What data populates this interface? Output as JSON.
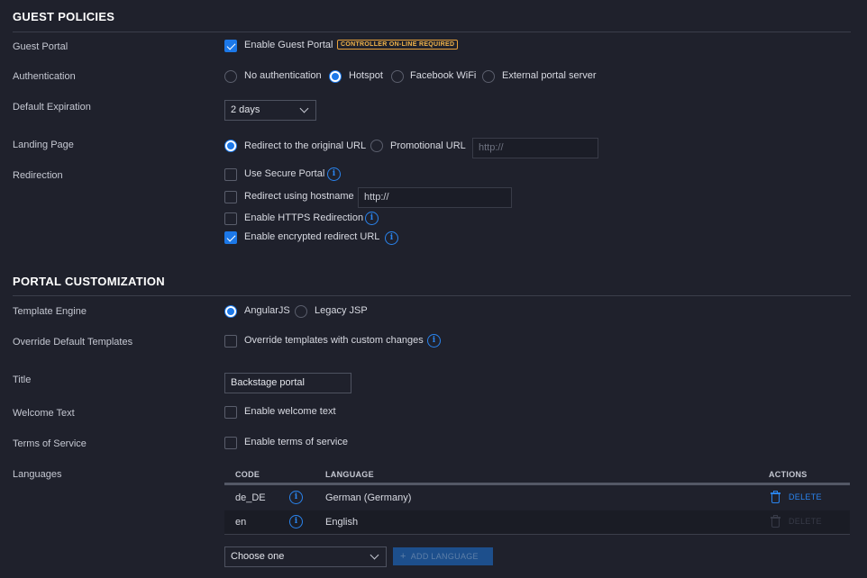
{
  "guest_policies": {
    "title": "GUEST POLICIES",
    "guest_portal": {
      "label": "Guest Portal",
      "checkbox_label": "Enable Guest Portal",
      "checked": true,
      "badge": "CONTROLLER ON-LINE REQUIRED"
    },
    "authentication": {
      "label": "Authentication",
      "options": [
        "No authentication",
        "Hotspot",
        "Facebook WiFi",
        "External portal server"
      ],
      "selected": "Hotspot"
    },
    "default_expiration": {
      "label": "Default Expiration",
      "value": "2 days"
    },
    "landing_page": {
      "label": "Landing Page",
      "options": [
        "Redirect to the original URL",
        "Promotional URL"
      ],
      "selected": "Redirect to the original URL",
      "url_placeholder": "http://"
    },
    "redirection": {
      "label": "Redirection",
      "use_secure_portal": "Use Secure Portal",
      "redirect_hostname": "Redirect using hostname",
      "hostname_value": "http://",
      "https_redirection": "Enable HTTPS Redirection",
      "encrypted_redirect": "Enable encrypted redirect URL"
    }
  },
  "portal_customization": {
    "title": "PORTAL CUSTOMIZATION",
    "template_engine": {
      "label": "Template Engine",
      "options": [
        "AngularJS",
        "Legacy JSP"
      ],
      "selected": "AngularJS"
    },
    "override_templates": {
      "label": "Override Default Templates",
      "checkbox_label": "Override templates with custom changes"
    },
    "title_field": {
      "label": "Title",
      "value": "Backstage  portal"
    },
    "welcome_text": {
      "label": "Welcome Text",
      "checkbox_label": "Enable welcome text"
    },
    "terms": {
      "label": "Terms of Service",
      "checkbox_label": "Enable terms of service"
    },
    "languages": {
      "label": "Languages",
      "columns": [
        "CODE",
        "LANGUAGE",
        "ACTIONS"
      ],
      "rows": [
        {
          "code": "de_DE",
          "language": "German (Germany)",
          "action": "DELETE"
        },
        {
          "code": "en",
          "language": "English",
          "action": "DELETE"
        }
      ],
      "choose_placeholder": "Choose one",
      "add_button": "ADD LANGUAGE"
    }
  },
  "info_icon_glyph": "i",
  "colors": {
    "accent": "#1c78e8",
    "background": "#1f212c",
    "badge": "#e9a23a"
  }
}
